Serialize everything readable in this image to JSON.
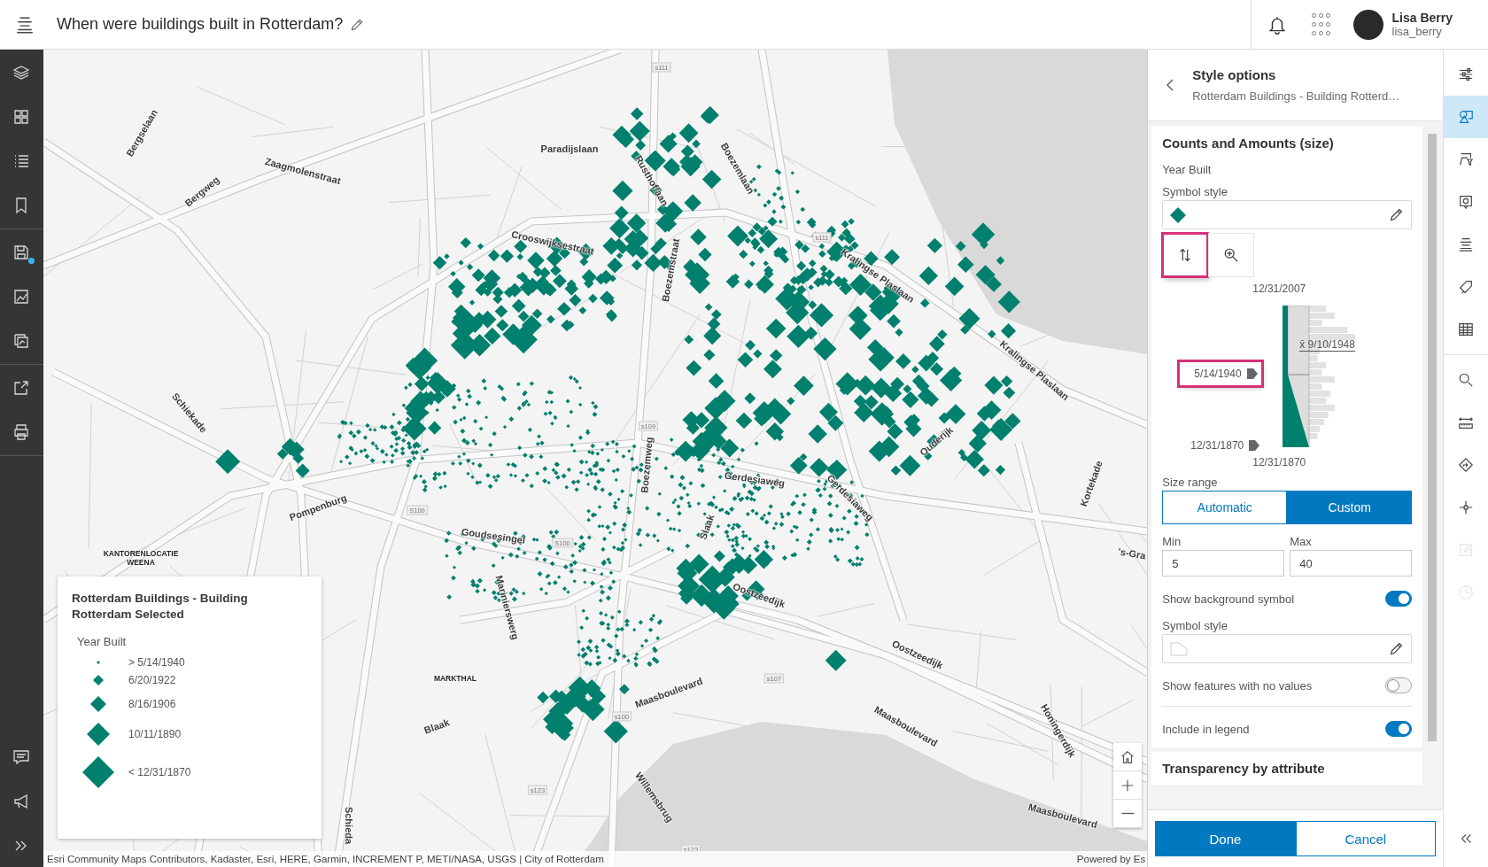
{
  "header": {
    "title": "When were buildings built in Rotterdam?",
    "user": {
      "name": "Lisa Berry",
      "username": "lisa_berry"
    }
  },
  "map": {
    "street_labels": [
      {
        "text": "Bergselaan",
        "kind": "street"
      },
      {
        "text": "Zaagmolenstraat",
        "kind": "street"
      },
      {
        "text": "Bergweg",
        "kind": "street"
      },
      {
        "text": "s111",
        "kind": "shield"
      },
      {
        "text": "Paradijslaan",
        "kind": "street"
      },
      {
        "text": "Rusthoflaan",
        "kind": "street"
      },
      {
        "text": "Boezemlaan",
        "kind": "street"
      },
      {
        "text": "Crooswijksestraat",
        "kind": "street"
      },
      {
        "text": "s111",
        "kind": "shield"
      },
      {
        "text": "Boezemstraat",
        "kind": "street"
      },
      {
        "text": "Kralingse Plaslaan",
        "kind": "street"
      },
      {
        "text": "Kralingse Plaslaan",
        "kind": "street"
      },
      {
        "text": "Schiekade",
        "kind": "street"
      },
      {
        "text": "s109",
        "kind": "shield"
      },
      {
        "text": "Ouderijk",
        "kind": "street"
      },
      {
        "text": "Boezemweg",
        "kind": "street"
      },
      {
        "text": "Gerdesiaweg",
        "kind": "street"
      },
      {
        "text": "Gerdesiaweg",
        "kind": "street"
      },
      {
        "text": "Kortekade",
        "kind": "street"
      },
      {
        "text": "Pompenburg",
        "kind": "street"
      },
      {
        "text": "S100",
        "kind": "shield"
      },
      {
        "text": "Goudsesingel",
        "kind": "street"
      },
      {
        "text": "S100",
        "kind": "shield"
      },
      {
        "text": "Slaak",
        "kind": "street"
      },
      {
        "text": "KANTORENLOCATIE WEENA",
        "kind": "place"
      },
      {
        "text": "'s-Gra",
        "kind": "street"
      },
      {
        "text": "Marinierswerg",
        "kind": "street"
      },
      {
        "text": "Oostzeedijk",
        "kind": "street"
      },
      {
        "text": "Oostzeedijk",
        "kind": "street"
      },
      {
        "text": "MARKTHAL",
        "kind": "place"
      },
      {
        "text": "s107",
        "kind": "shield"
      },
      {
        "text": "Maasboulevard",
        "kind": "street"
      },
      {
        "text": "s100",
        "kind": "shield"
      },
      {
        "text": "Blaak",
        "kind": "street"
      },
      {
        "text": "Maasboulevard",
        "kind": "street"
      },
      {
        "text": "Honingerdijk",
        "kind": "street"
      },
      {
        "text": "s123",
        "kind": "shield"
      },
      {
        "text": "Willemsbrug",
        "kind": "street"
      },
      {
        "text": "Maasboulevard",
        "kind": "street"
      },
      {
        "text": "Schieda",
        "kind": "street"
      },
      {
        "text": "s123",
        "kind": "shield"
      }
    ],
    "legend": {
      "title": "Rotterdam Buildings - Building Rotterdam Selected",
      "field": "Year Built",
      "items": [
        {
          "label": "> 5/14/1940"
        },
        {
          "label": "6/20/1922"
        },
        {
          "label": "8/16/1906"
        },
        {
          "label": "10/11/1890"
        },
        {
          "label": "< 12/31/1870"
        }
      ]
    },
    "attribution": "Esri Community Maps Contributors, Kadaster, Esri, HERE, Garmin, INCREMENT P, METI/NASA, USGS | City of Rotterdam",
    "powered_by": "Powered by Es"
  },
  "style_panel": {
    "title": "Style options",
    "subtitle": "Rotterdam Buildings - Building Rotterd…",
    "card": {
      "title": "Counts and Amounts (size)",
      "field": "Year Built",
      "symbol_label": "Symbol style",
      "histogram": {
        "top": "12/31/2007",
        "bottom": "12/31/1870",
        "handle_upper": "5/14/1940",
        "handle_lower": "12/31/1870",
        "average": "x̄ 9/10/1948"
      },
      "size_range": {
        "label": "Size range",
        "options": [
          {
            "label": "Automatic",
            "selected": false
          },
          {
            "label": "Custom",
            "selected": true
          }
        ]
      },
      "min": {
        "label": "Min",
        "value": "5"
      },
      "max": {
        "label": "Max",
        "value": "40"
      },
      "rows": [
        {
          "kind": "toggle",
          "label": "Show background symbol",
          "on": true
        },
        {
          "kind": "symbol",
          "label": "Symbol style"
        },
        {
          "kind": "toggle",
          "label": "Show features with no values",
          "on": false
        },
        {
          "kind": "divider"
        },
        {
          "kind": "toggle",
          "label": "Include in legend",
          "on": true
        }
      ]
    },
    "next_section": "Transparency by attribute",
    "buttons": [
      {
        "label": "Done",
        "primary": true
      },
      {
        "label": "Cancel",
        "primary": false
      }
    ]
  },
  "right_toolbar": {
    "items": [
      {
        "selected": false,
        "disabled": false
      },
      {
        "selected": true,
        "disabled": false
      },
      {
        "selected": false,
        "disabled": false
      },
      {
        "selected": false,
        "disabled": false
      },
      {
        "selected": false,
        "disabled": false
      },
      {
        "selected": false,
        "disabled": false
      },
      {
        "selected": false,
        "disabled": false
      },
      {
        "selected": false,
        "disabled": false
      },
      {
        "selected": false,
        "disabled": false
      },
      {
        "selected": false,
        "disabled": false
      },
      {
        "selected": false,
        "disabled": false
      },
      {
        "selected": false,
        "disabled": true
      },
      {
        "selected": false,
        "disabled": true
      }
    ]
  }
}
